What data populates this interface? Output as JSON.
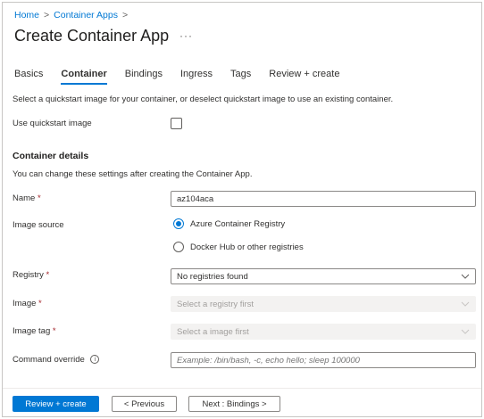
{
  "breadcrumb": {
    "home": "Home",
    "container_apps": "Container Apps",
    "separator": ">"
  },
  "page": {
    "title": "Create Container App",
    "more": "···"
  },
  "tabs": [
    {
      "label": "Basics",
      "active": false
    },
    {
      "label": "Container",
      "active": true
    },
    {
      "label": "Bindings",
      "active": false
    },
    {
      "label": "Ingress",
      "active": false
    },
    {
      "label": "Tags",
      "active": false
    },
    {
      "label": "Review + create",
      "active": false
    }
  ],
  "quickstart": {
    "description": "Select a quickstart image for your container, or deselect quickstart image to use an existing container.",
    "label": "Use quickstart image",
    "checked": false
  },
  "details": {
    "heading": "Container details",
    "description": "You can change these settings after creating the Container App."
  },
  "form": {
    "name": {
      "label": "Name",
      "required_mark": "*",
      "value": "az104aca"
    },
    "image_source": {
      "label": "Image source",
      "options": [
        {
          "label": "Azure Container Registry",
          "selected": true
        },
        {
          "label": "Docker Hub or other registries",
          "selected": false
        }
      ]
    },
    "registry": {
      "label": "Registry",
      "required_mark": "*",
      "value": "No registries found"
    },
    "image": {
      "label": "Image",
      "required_mark": "*",
      "value": "Select a registry first"
    },
    "image_tag": {
      "label": "Image tag",
      "required_mark": "*",
      "value": "Select a image first"
    },
    "command_override": {
      "label": "Command override",
      "info": "i",
      "placeholder": "Example: /bin/bash, -c, echo hello; sleep 100000"
    }
  },
  "footer": {
    "review_create": "Review + create",
    "previous": "< Previous",
    "next": "Next : Bindings >"
  },
  "colors": {
    "accent": "#0078d4",
    "required": "#a4262c",
    "disabled_bg": "#f3f2f1"
  }
}
